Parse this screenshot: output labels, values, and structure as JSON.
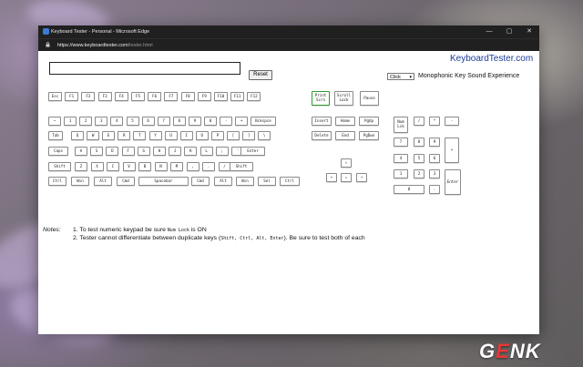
{
  "window": {
    "title": "Keyboard Tester - Personal - Microsoft Edge",
    "url_host": "https://www.keyboardtester.com",
    "url_path": "/tester.html",
    "controls": {
      "minimize": "—",
      "maximize": "▢",
      "close": "✕"
    }
  },
  "page": {
    "reset_label": "Reset",
    "brand": "KeyboardTester.com",
    "sound_select": "Click",
    "sound_label": "Monophonic Key Sound Experience"
  },
  "keys": {
    "fn": [
      "Esc",
      "F1",
      "F2",
      "F3",
      "F4",
      "F5",
      "F6",
      "F7",
      "F8",
      "F9",
      "F10",
      "F11",
      "F12"
    ],
    "row_num": [
      "~",
      "1",
      "2",
      "3",
      "4",
      "5",
      "6",
      "7",
      "8",
      "9",
      "0",
      "-",
      "+",
      "Bckspce"
    ],
    "row_q": [
      "Tab",
      "Q",
      "W",
      "E",
      "R",
      "T",
      "Y",
      "U",
      "I",
      "O",
      "P",
      "[",
      "]",
      "\\"
    ],
    "row_a": [
      "Caps",
      "A",
      "S",
      "D",
      "F",
      "G",
      "H",
      "J",
      "K",
      "L",
      ";",
      "'",
      "Enter"
    ],
    "row_z": [
      "Shift",
      "Z",
      "X",
      "C",
      "V",
      "B",
      "N",
      "M",
      ",",
      ".",
      "/",
      "Shift"
    ],
    "row_bottom": [
      "Ctrl",
      "Win",
      "Alt",
      "Cmd",
      "Spacebar",
      "Cmd",
      "Alt",
      "Win",
      "Sel",
      "Ctrl"
    ],
    "sys": [
      "Print\nScrn",
      "Scroll\nLock",
      "Pause"
    ],
    "nav_top": [
      "Insert",
      "Home",
      "PgUp"
    ],
    "nav_bot": [
      "Delete",
      "End",
      "PgDwn"
    ],
    "arrows": [
      "↑",
      "←",
      "↓",
      "→"
    ],
    "numpad": [
      "Num\nLck",
      "/",
      "*",
      "-",
      "7",
      "8",
      "9",
      "+",
      "4",
      "5",
      "6",
      "1",
      "2",
      "3",
      "Enter",
      "0",
      "."
    ]
  },
  "notes": {
    "label": "Notes:",
    "line1_pre": "1. To test numeric keypad be sure ",
    "line1_key": "Num Lock",
    "line1_post": " is ON",
    "line2_pre": "2. Tester cannot differentiate between duplicate keys (",
    "line2_keys": "Shift, Ctrl, Alt, Enter",
    "line2_post": "). Be sure to test both of each"
  },
  "watermark": {
    "g": "G",
    "e": "E",
    "nk": "NK"
  }
}
